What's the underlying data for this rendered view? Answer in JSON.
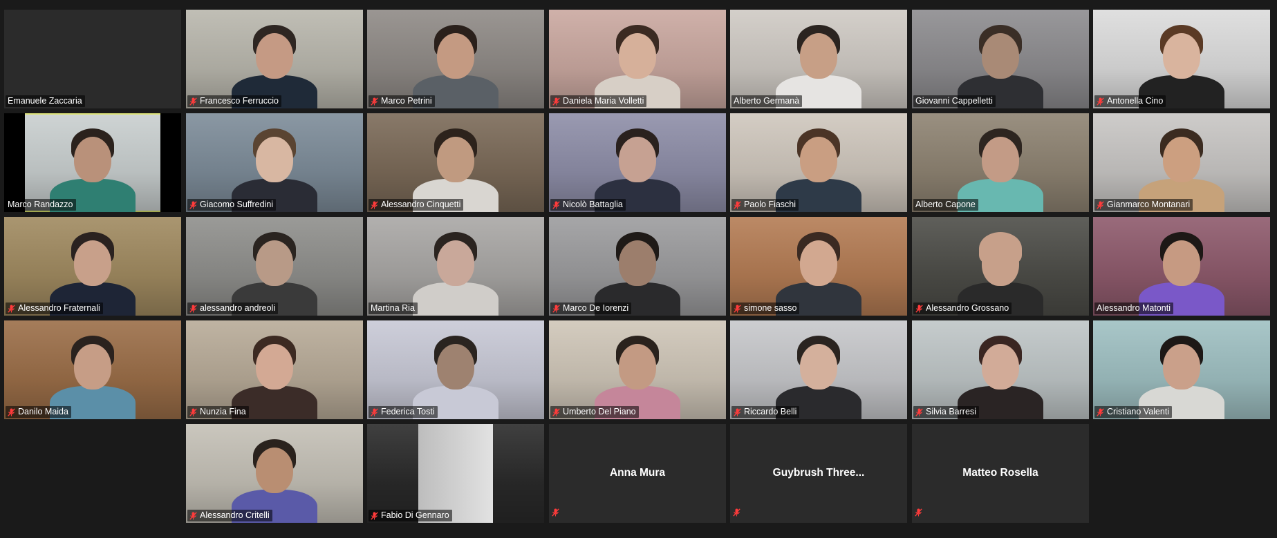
{
  "meeting": {
    "participants": [
      {
        "name": "Emanuele Zaccaria",
        "muted": false,
        "video": false,
        "bg": "#2b2b2b"
      },
      {
        "name": "Francesco Ferruccio",
        "muted": true,
        "video": true,
        "bg": "#b9b7ad",
        "skin": "#c59a84",
        "hair": "#2e2622",
        "shirt": "#1f2a38"
      },
      {
        "name": "Marco Petrini",
        "muted": true,
        "video": true,
        "bg": "#8f8a86",
        "skin": "#c49a82",
        "hair": "#2a201b",
        "shirt": "#5a6066"
      },
      {
        "name": "Daniela Maria Volletti",
        "muted": true,
        "video": true,
        "bg": "#caa8a0",
        "skin": "#d6b09a",
        "hair": "#3b2a22",
        "shirt": "#d7cfc6"
      },
      {
        "name": "Alberto Germanà",
        "muted": false,
        "video": true,
        "bg": "#cfcac4",
        "skin": "#c79f86",
        "hair": "#2b2420",
        "shirt": "#e6e4e2"
      },
      {
        "name": "Giovanni Cappelletti",
        "muted": false,
        "video": true,
        "bg": "#8d8c8f",
        "skin": "#a98a76",
        "hair": "#3a2e26",
        "shirt": "#2e2f33"
      },
      {
        "name": "Antonella Cino",
        "muted": true,
        "video": true,
        "bg": "#dcdcdc",
        "skin": "#d9b49e",
        "hair": "#5a3a25",
        "shirt": "#222222"
      },
      {
        "name": "Marco Randazzo",
        "muted": false,
        "video": true,
        "bg": "#c9cfcf",
        "skin": "#b9917a",
        "hair": "#2b221d",
        "shirt": "#2f7f72",
        "active": true
      },
      {
        "name": "Giacomo Suffredini",
        "muted": true,
        "video": true,
        "bg": "#7d8c99",
        "skin": "#d8b7a2",
        "hair": "#5a4432",
        "shirt": "#2a2c35"
      },
      {
        "name": "Alessandro Cinquetti",
        "muted": true,
        "video": true,
        "bg": "#7b6a58",
        "skin": "#c09a80",
        "hair": "#2d231c",
        "shirt": "#d9d6d1"
      },
      {
        "name": "Nicolò Battaglia",
        "muted": true,
        "video": true,
        "bg": "#8e8ea8",
        "skin": "#c6a192",
        "hair": "#2a211e",
        "shirt": "#2c3040"
      },
      {
        "name": "Paolo Fiaschi",
        "muted": true,
        "video": true,
        "bg": "#cfc7bd",
        "skin": "#c99e82",
        "hair": "#4b3426",
        "shirt": "#2e3a48"
      },
      {
        "name": "Alberto Capone",
        "muted": false,
        "video": true,
        "bg": "#8e8372",
        "skin": "#c39b86",
        "hair": "#2d2520",
        "shirt": "#68b8b0"
      },
      {
        "name": "Gianmarco Montanari",
        "muted": true,
        "video": true,
        "bg": "#c8c6c4",
        "skin": "#cc9f80",
        "hair": "#3b2b20",
        "shirt": "#c6a27a"
      },
      {
        "name": "Alessandro Fraternali",
        "muted": true,
        "video": true,
        "bg": "#a08a60",
        "skin": "#c8a08a",
        "hair": "#2a2220",
        "shirt": "#1e2536"
      },
      {
        "name": "alessandro andreoli",
        "muted": true,
        "video": true,
        "bg": "#8f8f8c",
        "skin": "#b89a87",
        "hair": "#2a2420",
        "shirt": "#3a3a3a"
      },
      {
        "name": "Martina Ria",
        "muted": false,
        "video": true,
        "bg": "#a9a7a5",
        "skin": "#c9a89a",
        "hair": "#2b2420",
        "shirt": "#d0cdc9"
      },
      {
        "name": "Marco De Iorenzi",
        "muted": true,
        "video": true,
        "bg": "#9c9c9e",
        "skin": "#9c7e6c",
        "hair": "#1f1a17",
        "shirt": "#2a2a2c"
      },
      {
        "name": "simone sasso",
        "muted": true,
        "video": true,
        "bg": "#b47c54",
        "skin": "#d2a890",
        "hair": "#3a2a22",
        "shirt": "#30353d"
      },
      {
        "name": "Alessandro Grossano",
        "muted": true,
        "video": true,
        "bg": "#4d4d48",
        "skin": "#c7a08a",
        "hair": "#c7a08a",
        "shirt": "#2a2a2a"
      },
      {
        "name": "Alessandro Matonti",
        "muted": false,
        "video": true,
        "bg": "#8e5a6c",
        "skin": "#c69a82",
        "hair": "#1d1816",
        "shirt": "#7a58c8"
      },
      {
        "name": "Danilo Maida",
        "muted": true,
        "video": true,
        "bg": "#9b6e48",
        "skin": "#c69d86",
        "hair": "#2a221e",
        "shirt": "#5b8fa8"
      },
      {
        "name": "Nunzia Fina",
        "muted": true,
        "video": true,
        "bg": "#b8ab98",
        "skin": "#d3a994",
        "hair": "#3c2a22",
        "shirt": "#3b2c28"
      },
      {
        "name": "Federica Tosti",
        "muted": true,
        "video": true,
        "bg": "#c8c9d6",
        "skin": "#9e8270",
        "hair": "#2a2420",
        "shirt": "#c8c9d6"
      },
      {
        "name": "Umberto Del Piano",
        "muted": true,
        "video": true,
        "bg": "#cfc6b8",
        "skin": "#c39a83",
        "hair": "#2a221d",
        "shirt": "#c5869a"
      },
      {
        "name": "Riccardo Belli",
        "muted": true,
        "video": true,
        "bg": "#c7c8cb",
        "skin": "#d4b09c",
        "hair": "#2a2420",
        "shirt": "#2a2a2d"
      },
      {
        "name": "Silvia Barresi",
        "muted": true,
        "video": true,
        "bg": "#bfc6c7",
        "skin": "#d2ab98",
        "hair": "#3a2622",
        "shirt": "#2a2424"
      },
      {
        "name": "Cristiano Valenti",
        "muted": true,
        "video": true,
        "bg": "#9fc0c2",
        "skin": "#caa08a",
        "hair": "#1d1816",
        "shirt": "#d8d8d4"
      },
      {
        "name": "",
        "muted": false,
        "video": false,
        "empty": true
      },
      {
        "name": "Alessandro Critelli",
        "muted": true,
        "video": true,
        "bg": "#c4c0b6",
        "skin": "#b98e72",
        "hair": "#2a221d",
        "shirt": "#5a5aa8"
      },
      {
        "name": "Fabio Di Gennaro",
        "muted": true,
        "video": true,
        "bg": "#2a2a2a",
        "skin": "#cfcfcf",
        "hair": "#cfcfcf",
        "shirt": "#cfcfcf",
        "partial": true
      },
      {
        "name": "Anna Mura",
        "muted": true,
        "video": false,
        "bg": "#2b2b2b"
      },
      {
        "name": "Guybrush  Three...",
        "muted": true,
        "video": false,
        "bg": "#2b2b2b"
      },
      {
        "name": "Matteo Rosella",
        "muted": true,
        "video": false,
        "bg": "#2b2b2b"
      },
      {
        "name": "",
        "muted": false,
        "video": false,
        "empty": true
      }
    ]
  }
}
